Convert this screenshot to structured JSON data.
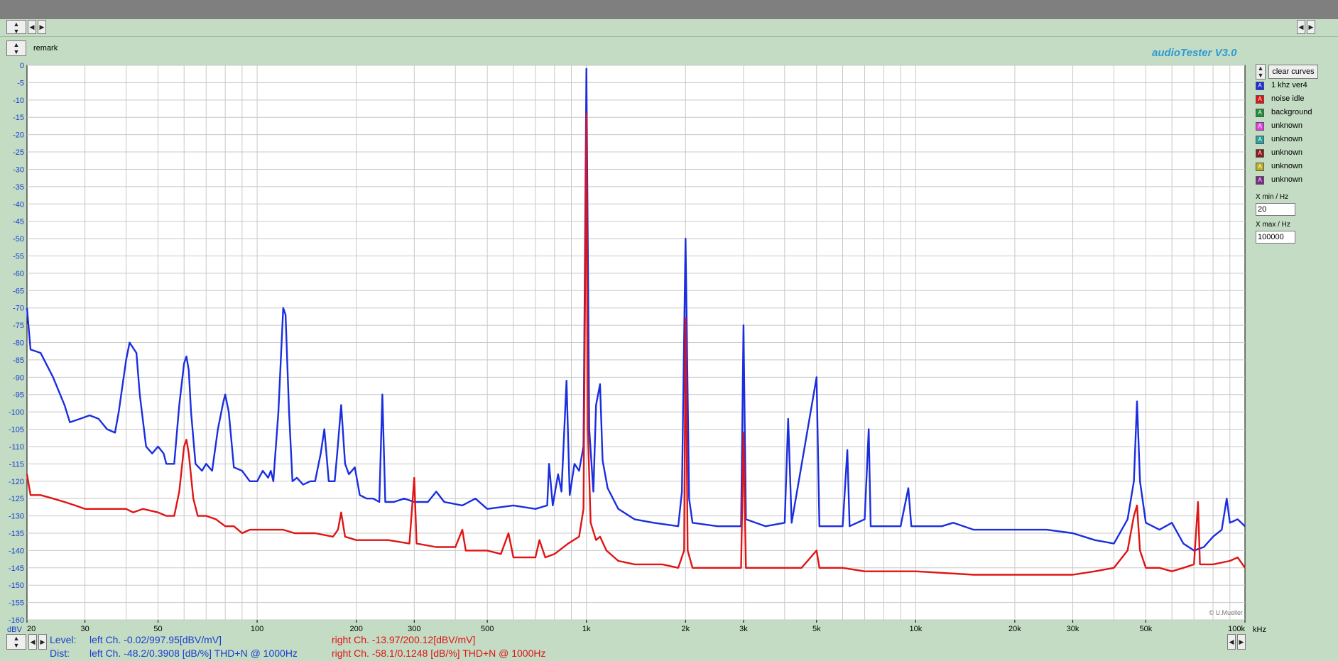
{
  "window": {
    "remark_label": "remark",
    "brand": "audioTester  V3.0",
    "copyright": "© U.Mueller"
  },
  "legend": {
    "clear_label": "clear curves",
    "items": [
      {
        "label": "1 khz ver4",
        "color": "#1a2ee0"
      },
      {
        "label": "noise idle",
        "color": "#e01414"
      },
      {
        "label": "background",
        "color": "#1f8f3a"
      },
      {
        "label": "unknown",
        "color": "#e040e0"
      },
      {
        "label": "unknown",
        "color": "#2aa0a0"
      },
      {
        "label": "unknown",
        "color": "#8b1a1a"
      },
      {
        "label": "unknown",
        "color": "#b8b020"
      },
      {
        "label": "unknown",
        "color": "#7a2a8a"
      }
    ]
  },
  "xrange": {
    "min_label": "min / Hz",
    "min_value": "20",
    "max_label": "max / Hz",
    "max_value": "100000"
  },
  "status": {
    "level_label": "Level:",
    "dist_label": "Dist:",
    "level_left": "left Ch. -0.02/997.95[dBV/mV]",
    "level_right": "right Ch. -13.97/200.12[dBV/mV]",
    "dist_left": "left Ch. -48.2/0.3908 [dB/%] THD+N  @ 1000Hz",
    "dist_right": "right Ch. -58.1/0.1248 [dB/%] THD+N  @ 1000Hz"
  },
  "chart_data": {
    "type": "line",
    "ylabel": "dBV",
    "xlabel": "",
    "xunit": "kHz",
    "xscale": "log",
    "xlim": [
      20,
      100000
    ],
    "ylim": [
      -160,
      0
    ],
    "grid": true,
    "legend_position": "right",
    "x_tick_labels": [
      {
        "v": 20,
        "t": "20"
      },
      {
        "v": 30,
        "t": "30"
      },
      {
        "v": 50,
        "t": "50"
      },
      {
        "v": 100,
        "t": "100"
      },
      {
        "v": 200,
        "t": "200"
      },
      {
        "v": 300,
        "t": "300"
      },
      {
        "v": 500,
        "t": "500"
      },
      {
        "v": 1000,
        "t": "1k"
      },
      {
        "v": 2000,
        "t": "2k"
      },
      {
        "v": 3000,
        "t": "3k"
      },
      {
        "v": 5000,
        "t": "5k"
      },
      {
        "v": 10000,
        "t": "10k"
      },
      {
        "v": 20000,
        "t": "20k"
      },
      {
        "v": 30000,
        "t": "30k"
      },
      {
        "v": 50000,
        "t": "50k"
      },
      {
        "v": 100000,
        "t": "100k"
      }
    ],
    "y_ticks": [
      0,
      -5,
      -10,
      -15,
      -20,
      -25,
      -30,
      -35,
      -40,
      -45,
      -50,
      -55,
      -60,
      -65,
      -70,
      -75,
      -80,
      -85,
      -90,
      -95,
      -100,
      -105,
      -110,
      -115,
      -120,
      -125,
      -130,
      -135,
      -140,
      -145,
      -150,
      -155,
      -160
    ],
    "series": [
      {
        "name": "1 khz ver4",
        "color": "#1a2ee0",
        "points": [
          [
            20,
            -70
          ],
          [
            20.5,
            -82
          ],
          [
            22,
            -83
          ],
          [
            24,
            -90
          ],
          [
            26,
            -98
          ],
          [
            27,
            -103
          ],
          [
            29,
            -102
          ],
          [
            31,
            -101
          ],
          [
            33,
            -102
          ],
          [
            35,
            -105
          ],
          [
            37,
            -106
          ],
          [
            38,
            -100
          ],
          [
            40,
            -85
          ],
          [
            41,
            -80
          ],
          [
            43,
            -83
          ],
          [
            44,
            -95
          ],
          [
            46,
            -110
          ],
          [
            48,
            -112
          ],
          [
            50,
            -110
          ],
          [
            52,
            -112
          ],
          [
            53,
            -115
          ],
          [
            56,
            -115
          ],
          [
            58,
            -98
          ],
          [
            60,
            -86
          ],
          [
            61,
            -84
          ],
          [
            62,
            -88
          ],
          [
            63,
            -100
          ],
          [
            65,
            -115
          ],
          [
            68,
            -117
          ],
          [
            70,
            -115
          ],
          [
            73,
            -117
          ],
          [
            76,
            -105
          ],
          [
            79,
            -97
          ],
          [
            80,
            -95
          ],
          [
            82,
            -100
          ],
          [
            85,
            -116
          ],
          [
            90,
            -117
          ],
          [
            95,
            -120
          ],
          [
            100,
            -120
          ],
          [
            104,
            -117
          ],
          [
            108,
            -119
          ],
          [
            110,
            -117
          ],
          [
            112,
            -120
          ],
          [
            116,
            -100
          ],
          [
            120,
            -70
          ],
          [
            122,
            -72
          ],
          [
            125,
            -100
          ],
          [
            128,
            -120
          ],
          [
            132,
            -119
          ],
          [
            138,
            -121
          ],
          [
            145,
            -120
          ],
          [
            150,
            -120
          ],
          [
            156,
            -112
          ],
          [
            160,
            -105
          ],
          [
            165,
            -120
          ],
          [
            172,
            -120
          ],
          [
            175,
            -112
          ],
          [
            180,
            -98
          ],
          [
            185,
            -115
          ],
          [
            190,
            -118
          ],
          [
            198,
            -116
          ],
          [
            205,
            -124
          ],
          [
            215,
            -125
          ],
          [
            225,
            -125
          ],
          [
            235,
            -126
          ],
          [
            240,
            -95
          ],
          [
            245,
            -126
          ],
          [
            260,
            -126
          ],
          [
            280,
            -125
          ],
          [
            300,
            -126
          ],
          [
            330,
            -126
          ],
          [
            350,
            -123
          ],
          [
            370,
            -126
          ],
          [
            420,
            -127
          ],
          [
            460,
            -125
          ],
          [
            500,
            -128
          ],
          [
            600,
            -127
          ],
          [
            700,
            -128
          ],
          [
            760,
            -127
          ],
          [
            770,
            -115
          ],
          [
            790,
            -127
          ],
          [
            820,
            -118
          ],
          [
            840,
            -123
          ],
          [
            870,
            -91
          ],
          [
            890,
            -124
          ],
          [
            920,
            -115
          ],
          [
            950,
            -117
          ],
          [
            980,
            -110
          ],
          [
            1000,
            -1
          ],
          [
            1020,
            -105
          ],
          [
            1050,
            -123
          ],
          [
            1070,
            -98
          ],
          [
            1100,
            -92
          ],
          [
            1120,
            -114
          ],
          [
            1160,
            -122
          ],
          [
            1250,
            -128
          ],
          [
            1400,
            -131
          ],
          [
            1600,
            -132
          ],
          [
            1900,
            -133
          ],
          [
            1950,
            -123
          ],
          [
            2000,
            -50
          ],
          [
            2050,
            -125
          ],
          [
            2100,
            -132
          ],
          [
            2500,
            -133
          ],
          [
            2950,
            -133
          ],
          [
            3000,
            -75
          ],
          [
            3050,
            -131
          ],
          [
            3500,
            -133
          ],
          [
            4000,
            -132
          ],
          [
            4100,
            -102
          ],
          [
            4200,
            -132
          ],
          [
            5000,
            -90
          ],
          [
            5100,
            -133
          ],
          [
            6000,
            -133
          ],
          [
            6200,
            -111
          ],
          [
            6300,
            -133
          ],
          [
            7000,
            -131
          ],
          [
            7200,
            -105
          ],
          [
            7300,
            -133
          ],
          [
            9000,
            -133
          ],
          [
            9500,
            -122
          ],
          [
            9700,
            -133
          ],
          [
            12000,
            -133
          ],
          [
            13000,
            -132
          ],
          [
            15000,
            -134
          ],
          [
            20000,
            -134
          ],
          [
            25000,
            -134
          ],
          [
            30000,
            -135
          ],
          [
            35000,
            -137
          ],
          [
            40000,
            -138
          ],
          [
            44000,
            -131
          ],
          [
            46000,
            -120
          ],
          [
            47000,
            -97
          ],
          [
            48000,
            -120
          ],
          [
            50000,
            -132
          ],
          [
            55000,
            -134
          ],
          [
            60000,
            -132
          ],
          [
            65000,
            -138
          ],
          [
            70000,
            -140
          ],
          [
            75000,
            -139
          ],
          [
            80000,
            -136
          ],
          [
            85000,
            -134
          ],
          [
            88000,
            -125
          ],
          [
            90000,
            -132
          ],
          [
            95000,
            -131
          ],
          [
            100000,
            -133
          ]
        ]
      },
      {
        "name": "noise idle",
        "color": "#e01414",
        "points": [
          [
            20,
            -118
          ],
          [
            20.5,
            -124
          ],
          [
            22,
            -124
          ],
          [
            24,
            -125
          ],
          [
            26,
            -126
          ],
          [
            28,
            -127
          ],
          [
            30,
            -128
          ],
          [
            35,
            -128
          ],
          [
            40,
            -128
          ],
          [
            42,
            -129
          ],
          [
            45,
            -128
          ],
          [
            50,
            -129
          ],
          [
            53,
            -130
          ],
          [
            56,
            -130
          ],
          [
            58,
            -123
          ],
          [
            60,
            -110
          ],
          [
            61,
            -108
          ],
          [
            62,
            -112
          ],
          [
            64,
            -125
          ],
          [
            66,
            -130
          ],
          [
            70,
            -130
          ],
          [
            75,
            -131
          ],
          [
            80,
            -133
          ],
          [
            85,
            -133
          ],
          [
            90,
            -135
          ],
          [
            95,
            -134
          ],
          [
            100,
            -134
          ],
          [
            110,
            -134
          ],
          [
            120,
            -134
          ],
          [
            130,
            -135
          ],
          [
            150,
            -135
          ],
          [
            170,
            -136
          ],
          [
            176,
            -134
          ],
          [
            180,
            -129
          ],
          [
            185,
            -136
          ],
          [
            200,
            -137
          ],
          [
            250,
            -137
          ],
          [
            290,
            -138
          ],
          [
            300,
            -119
          ],
          [
            305,
            -138
          ],
          [
            350,
            -139
          ],
          [
            400,
            -139
          ],
          [
            420,
            -134
          ],
          [
            430,
            -140
          ],
          [
            500,
            -140
          ],
          [
            550,
            -141
          ],
          [
            580,
            -135
          ],
          [
            600,
            -142
          ],
          [
            700,
            -142
          ],
          [
            720,
            -137
          ],
          [
            750,
            -142
          ],
          [
            800,
            -141
          ],
          [
            880,
            -138
          ],
          [
            950,
            -136
          ],
          [
            980,
            -128
          ],
          [
            1000,
            -14
          ],
          [
            1010,
            -105
          ],
          [
            1030,
            -132
          ],
          [
            1070,
            -137
          ],
          [
            1100,
            -136
          ],
          [
            1150,
            -140
          ],
          [
            1250,
            -143
          ],
          [
            1400,
            -144
          ],
          [
            1700,
            -144
          ],
          [
            1900,
            -145
          ],
          [
            1980,
            -140
          ],
          [
            2000,
            -73
          ],
          [
            2030,
            -140
          ],
          [
            2100,
            -145
          ],
          [
            2500,
            -145
          ],
          [
            2950,
            -145
          ],
          [
            3000,
            -106
          ],
          [
            3050,
            -145
          ],
          [
            3500,
            -145
          ],
          [
            4000,
            -145
          ],
          [
            4500,
            -145
          ],
          [
            5000,
            -140
          ],
          [
            5100,
            -145
          ],
          [
            6000,
            -145
          ],
          [
            7000,
            -146
          ],
          [
            8000,
            -146
          ],
          [
            10000,
            -146
          ],
          [
            15000,
            -147
          ],
          [
            20000,
            -147
          ],
          [
            25000,
            -147
          ],
          [
            30000,
            -147
          ],
          [
            35000,
            -146
          ],
          [
            40000,
            -145
          ],
          [
            44000,
            -140
          ],
          [
            46000,
            -130
          ],
          [
            47000,
            -127
          ],
          [
            48000,
            -140
          ],
          [
            50000,
            -145
          ],
          [
            55000,
            -145
          ],
          [
            60000,
            -146
          ],
          [
            65000,
            -145
          ],
          [
            70000,
            -144
          ],
          [
            72000,
            -126
          ],
          [
            73000,
            -144
          ],
          [
            80000,
            -144
          ],
          [
            90000,
            -143
          ],
          [
            95000,
            -142
          ],
          [
            100000,
            -145
          ]
        ]
      }
    ]
  }
}
